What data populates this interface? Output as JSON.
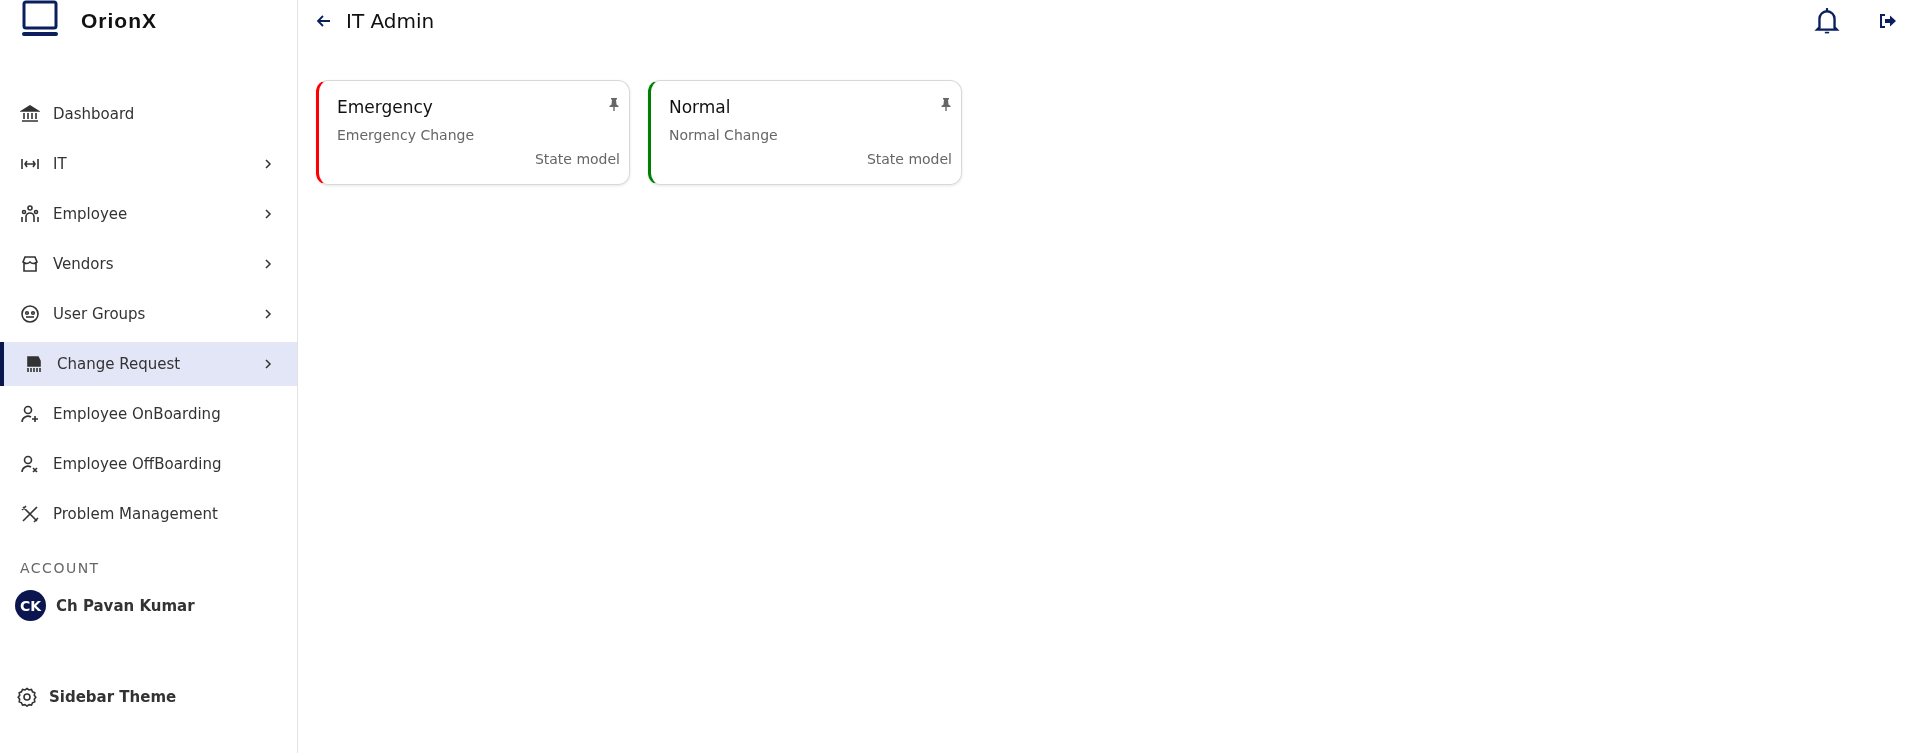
{
  "brand": {
    "name": "OrionX"
  },
  "sidebar": {
    "items": [
      {
        "label": "Dashboard",
        "has_submenu": false,
        "selected": false
      },
      {
        "label": "IT",
        "has_submenu": true,
        "selected": false
      },
      {
        "label": "Employee",
        "has_submenu": true,
        "selected": false
      },
      {
        "label": "Vendors",
        "has_submenu": true,
        "selected": false
      },
      {
        "label": "User Groups",
        "has_submenu": true,
        "selected": false
      },
      {
        "label": "Change Request",
        "has_submenu": true,
        "selected": true
      },
      {
        "label": "Employee OnBoarding",
        "has_submenu": false,
        "selected": false
      },
      {
        "label": "Employee OffBoarding",
        "has_submenu": false,
        "selected": false
      },
      {
        "label": "Problem Management",
        "has_submenu": false,
        "selected": false
      }
    ],
    "account_heading": "ACCOUNT",
    "user": {
      "initials": "CK",
      "name": "Ch Pavan Kumar"
    },
    "theme_button": "Sidebar Theme"
  },
  "header": {
    "title": "IT Admin"
  },
  "cards": [
    {
      "title": "Emergency",
      "subtitle": "Emergency Change",
      "footer": "State model",
      "color": "#ff0000"
    },
    {
      "title": "Normal",
      "subtitle": "Normal Change",
      "footer": "State model",
      "color": "#008000"
    }
  ]
}
